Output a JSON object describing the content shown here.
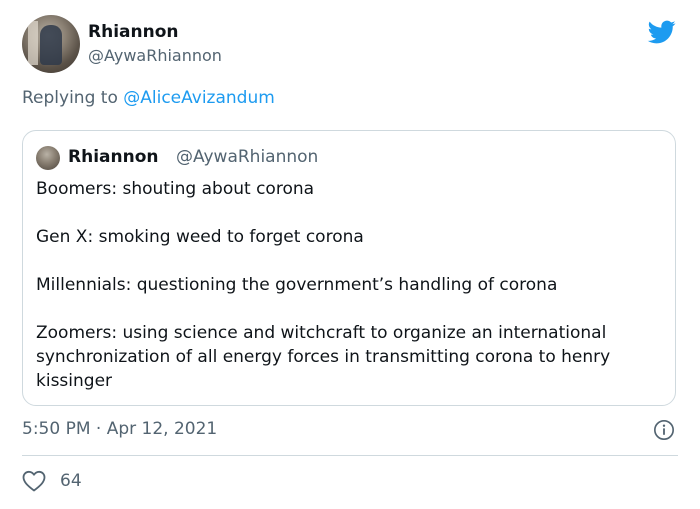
{
  "tweet": {
    "author_name": "Rhiannon",
    "author_handle": "@AywaRhiannon",
    "replying_prefix": "Replying to ",
    "replying_to": "@AliceAvizandum",
    "timestamp": "5:50 PM · Apr 12, 2021",
    "likes": "64"
  },
  "quoted_tweet": {
    "author_name": "Rhiannon",
    "author_handle": "@AywaRhiannon",
    "paragraphs": [
      "Boomers: shouting about corona",
      "Gen X: smoking weed to forget corona",
      "Millennials: questioning the government’s handling of corona",
      "Zoomers: using science and witchcraft to organize an international synchronization of all energy forces in transmitting corona to henry kissinger"
    ]
  },
  "icons": {
    "brand": "twitter-bird-icon",
    "info": "info-icon",
    "like": "heart-icon"
  },
  "colors": {
    "brand_blue": "#1d9bf0",
    "secondary_text": "#536471",
    "primary_text": "#0f1419",
    "border": "#cfd9de"
  }
}
